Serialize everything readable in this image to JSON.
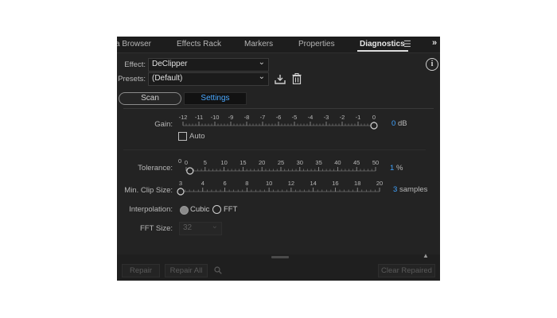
{
  "tabs": [
    {
      "label": "a Browser",
      "active": false
    },
    {
      "label": "Effects Rack",
      "active": false
    },
    {
      "label": "Markers",
      "active": false
    },
    {
      "label": "Properties",
      "active": false
    },
    {
      "label": "Diagnostics",
      "active": true
    }
  ],
  "tab_icons": {
    "menu": "hamburger-menu-icon",
    "overflow": "double-chevron-right-icon"
  },
  "side_button": {
    "glyph": "i",
    "icon": "info-icon"
  },
  "effect": {
    "label": "Effect:",
    "value": "DeClipper"
  },
  "presets": {
    "label": "Presets:",
    "value": "(Default)",
    "save_icon": "save-preset-icon",
    "delete_icon": "trash-icon"
  },
  "mode": {
    "scan_label": "Scan",
    "settings_label": "Settings",
    "selected": "Settings"
  },
  "gain": {
    "label": "Gain:",
    "ticks": [
      "-12",
      "-11",
      "-10",
      "-9",
      "-8",
      "-7",
      "-6",
      "-5",
      "-4",
      "-3",
      "-2",
      "-1",
      "0"
    ],
    "value": "0",
    "unit": "dB",
    "fraction": 1.0
  },
  "auto": {
    "label": "Auto",
    "checked": false
  },
  "tolerance": {
    "label": "Tolerance:",
    "ticks": [
      "0",
      "5",
      "10",
      "15",
      "20",
      "25",
      "30",
      "35",
      "40",
      "45",
      "50"
    ],
    "first_tick_extra": "0",
    "value": "1",
    "unit": "%",
    "fraction": 0.02
  },
  "min_clip_size": {
    "label": "Min. Clip Size:",
    "ticks": [
      "3",
      "4",
      "6",
      "8",
      "10",
      "12",
      "14",
      "16",
      "18",
      "20"
    ],
    "value": "3",
    "unit": "samples",
    "fraction": 0.0
  },
  "interpolation": {
    "label": "Interpolation:",
    "options": [
      "Cubic",
      "FFT"
    ],
    "selected": "Cubic"
  },
  "fft_size": {
    "label": "FFT Size:",
    "value": "32"
  },
  "footer": {
    "repair_label": "Repair",
    "repair_all_label": "Repair All",
    "search_icon": "search-icon",
    "clear_repaired_label": "Clear Repaired"
  },
  "colors": {
    "accent": "#3fa3ff",
    "panel_bg": "#232323",
    "text": "#c8c8c8"
  }
}
